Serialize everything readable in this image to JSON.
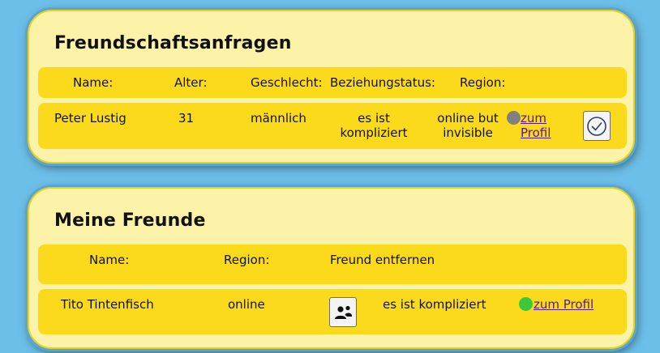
{
  "requests": {
    "title": "Freundschaftsanfragen",
    "headers": {
      "name": "Name:",
      "age": "Alter:",
      "gender": "Geschlecht:",
      "relationship": "Beziehungstatus:",
      "region": "Region:"
    },
    "row": {
      "name": "Peter Lustig",
      "age": "31",
      "gender": "männlich",
      "relationship_l1": "es ist",
      "relationship_l2": "kompliziert",
      "region_l1": "online but",
      "region_l2": "invisible",
      "status_color": "#808080",
      "profile_l1": "zum",
      "profile_l2": "Profil",
      "accept_icon": "check-circle-icon"
    }
  },
  "friends": {
    "title": "Meine Freunde",
    "headers": {
      "name": "Name:",
      "region": "Region:",
      "remove": "Freund entfernen"
    },
    "row": {
      "name": "Tito Tintenfisch",
      "region": "online",
      "remove_icon": "remove-friend-icon",
      "relationship": "es ist kompliziert",
      "status_color": "#3cc83c",
      "profile": "zum Profil"
    }
  },
  "colors": {
    "background": "#6cbfe8",
    "card": "#fdf3a8",
    "bar": "#fbda1c",
    "link": "#55198b"
  }
}
